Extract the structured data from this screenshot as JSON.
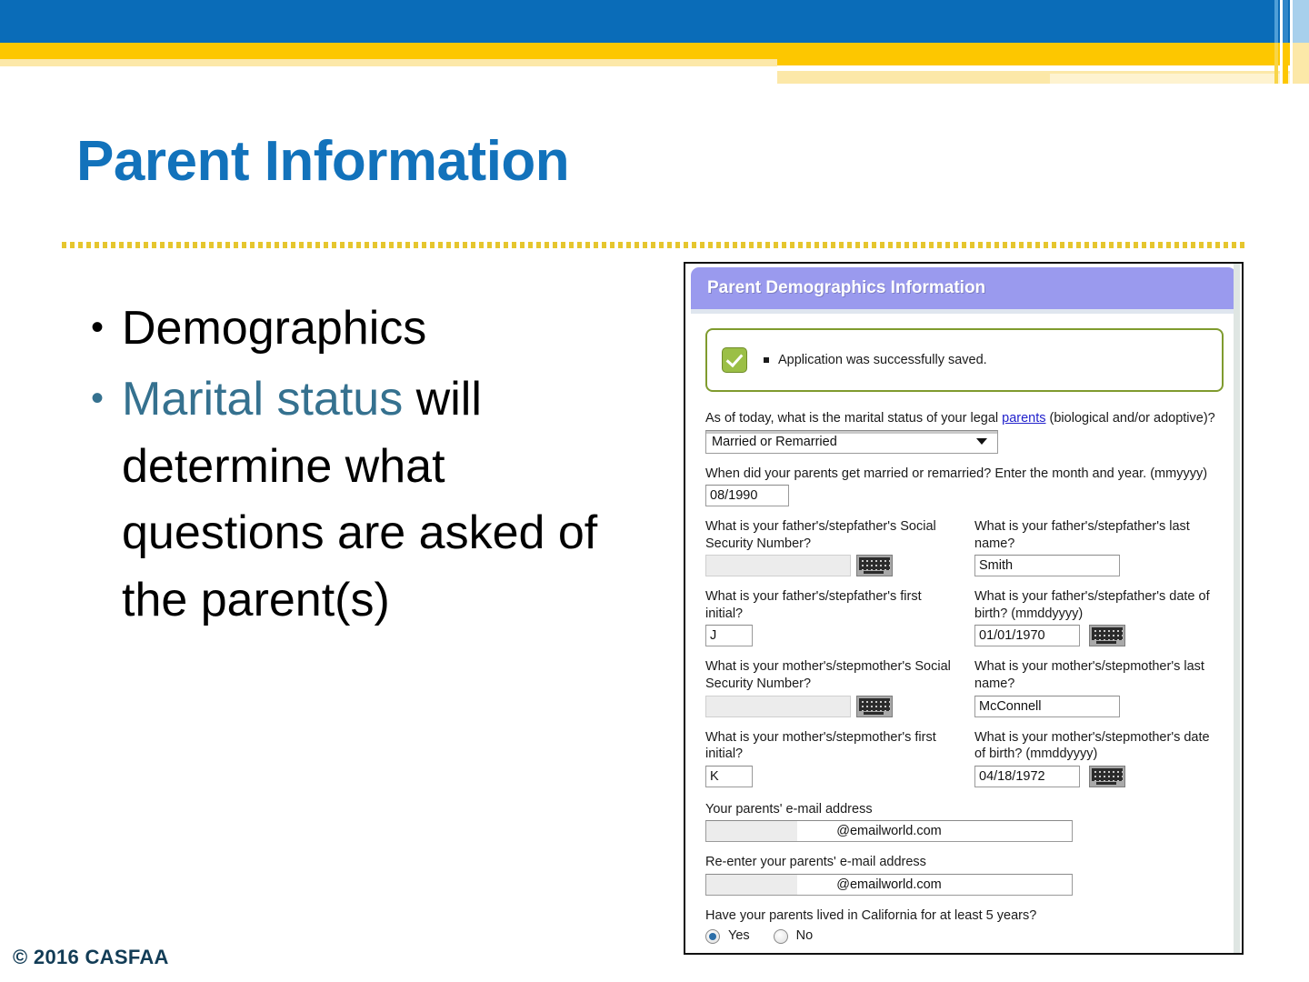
{
  "slide": {
    "title": "Parent Information",
    "footer": "© 2016 CASFAA",
    "accent_blue": "#1272bb",
    "accent_teal": "#35718f",
    "banner_blue": "#0a6cb8",
    "banner_gold": "#fdc700",
    "divider_color": "#e6c62e"
  },
  "bullets": [
    {
      "marker": "•",
      "lead": "",
      "highlight": "",
      "text": "Demographics"
    },
    {
      "marker": "•",
      "lead": "",
      "highlight": "Marital status",
      "text": " will determine what questions are asked of the parent(s)"
    }
  ],
  "screenshot": {
    "header_title": "Parent Demographics Information",
    "alert": {
      "icon": "check-icon",
      "message": "Application was successfully saved."
    },
    "marital": {
      "question_part1": "As of today, what is the marital status of your legal ",
      "question_link": "parents",
      "question_part2": " (biological and/or adoptive)?",
      "selected": "Married or Remarried",
      "options": [
        "Married or Remarried"
      ]
    },
    "married_date": {
      "question": "When did your parents get married or remarried? Enter the month and year. (mmyyyy)",
      "value": "08/1990"
    },
    "father": {
      "ssn_question": "What is your father's/stepfather's Social Security Number?",
      "ssn_value": "",
      "ssn_keypad_icon": "keyboard-icon",
      "lastname_question": "What is your father's/stepfather's last name?",
      "lastname_value": "Smith",
      "initial_question": "What is your father's/stepfather's first initial?",
      "initial_value": "J",
      "dob_question": "What is your father's/stepfather's date of birth? (mmddyyyy)",
      "dob_value": "01/01/1970",
      "dob_keypad_icon": "keyboard-icon"
    },
    "mother": {
      "ssn_question": "What is your mother's/stepmother's Social Security Number?",
      "ssn_value": "",
      "ssn_keypad_icon": "keyboard-icon",
      "lastname_question": "What is your mother's/stepmother's last name?",
      "lastname_value": "McConnell",
      "initial_question": "What is your mother's/stepmother's first initial?",
      "initial_value": "K",
      "dob_question": "What is your mother's/stepmother's date of birth? (mmddyyyy)",
      "dob_value": "04/18/1972",
      "dob_keypad_icon": "keyboard-icon"
    },
    "email": {
      "label": "Your parents' e-mail address",
      "value": "@emailworld.com"
    },
    "email_confirm": {
      "label": "Re-enter your parents' e-mail address",
      "value": "@emailworld.com"
    },
    "residency": {
      "question": "Have your parents lived in California for at least 5 years?",
      "yes_label": "Yes",
      "no_label": "No",
      "selected": "Yes"
    }
  }
}
